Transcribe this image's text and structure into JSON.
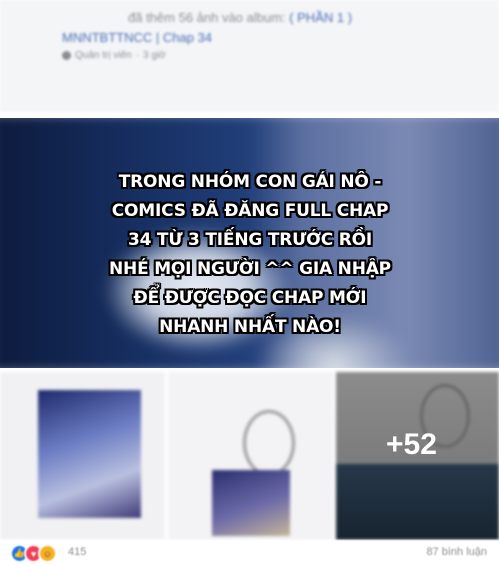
{
  "post": {
    "added_prefix": "đã thêm 56 ảnh vào album:",
    "album_name": "( PHẦN 1 )",
    "album_link": "MNNTBTTNCC | Chap 34",
    "role": "Quản trị viên",
    "time": "3 giờ"
  },
  "hero": {
    "caption_lines": [
      "TRONG NHÓM CON GÁI NÔ -",
      "COMICS ĐÃ ĐĂNG FULL CHAP",
      "34 TỪ 3 TIẾNG TRƯỚC RỒI",
      "NHÉ MỌI NGƯỜI ^^ GIA NHẬP",
      "ĐỂ ĐƯỢC ĐỌC CHAP MỚI",
      "NHANH NHẤT NÀO!"
    ]
  },
  "gallery": {
    "more_count": "+52"
  },
  "footer": {
    "reactions": [
      "like-icon",
      "love-icon",
      "haha-icon"
    ],
    "reaction_count": "415",
    "comments": "87 bình luận"
  }
}
